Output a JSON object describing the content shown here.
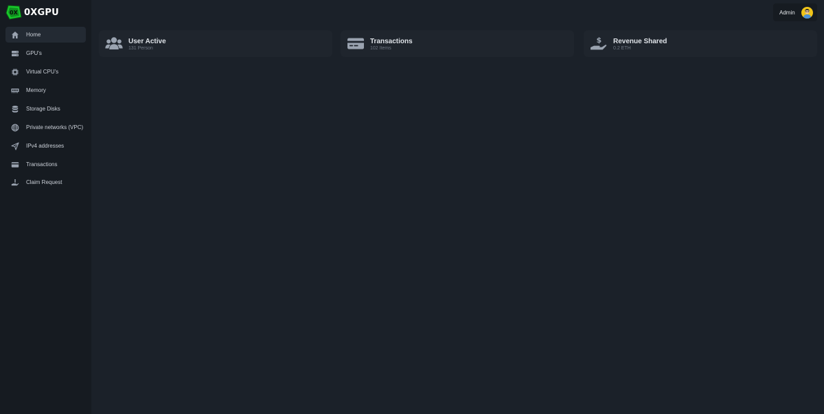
{
  "brand": {
    "name": "0XGPU",
    "logo_text": "0X",
    "accent": "#18c92b"
  },
  "sidebar": {
    "items": [
      {
        "label": "Home",
        "icon": "home-icon",
        "active": true
      },
      {
        "label": "GPU's",
        "icon": "server-icon",
        "active": false
      },
      {
        "label": "Virtual CPU's",
        "icon": "cpu-icon",
        "active": false
      },
      {
        "label": "Memory",
        "icon": "memory-icon",
        "active": false
      },
      {
        "label": "Storage Disks",
        "icon": "database-icon",
        "active": false
      },
      {
        "label": "Private networks (VPC)",
        "icon": "globe-icon",
        "active": false
      },
      {
        "label": "IPv4 addresses",
        "icon": "send-icon",
        "active": false
      },
      {
        "label": "Transactions",
        "icon": "credit-card-icon",
        "active": false
      },
      {
        "label": "Claim Request",
        "icon": "hand-icon",
        "active": false
      }
    ]
  },
  "header": {
    "user": {
      "name": "Admin",
      "avatar": "avatar"
    }
  },
  "stats": [
    {
      "title": "User Active",
      "value": "131 Person",
      "icon": "users-icon"
    },
    {
      "title": "Transactions",
      "value": "102 Items",
      "icon": "credit-card-icon"
    },
    {
      "title": "Revenue Shared",
      "value": "0.2 ETH",
      "icon": "hand-dollar-icon"
    }
  ],
  "colors": {
    "background": "#1b2129",
    "sidebar": "#161b21",
    "card": "#1f252d",
    "icon": "#9aa3b0"
  }
}
